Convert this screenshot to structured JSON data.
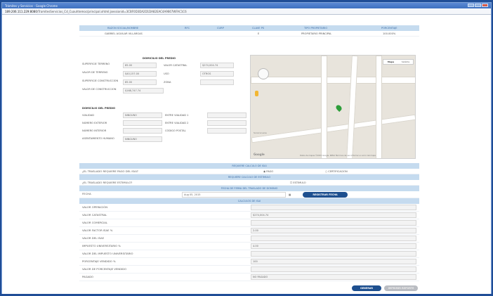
{
  "window": {
    "title": "Trámites y Servicios - Google Chrome"
  },
  "url": {
    "host": "189.206.111.229:8080",
    "path": "/TramitesServicios_Cd_Cuauhtemoc/principal.xhtml;jsessionid=3CBF0D3DA2D1DA82EAC4A9667WFAC1C6"
  },
  "owner": {
    "headers": [
      "RAZON SOCIAL/NOMBRE",
      "RFC",
      "CURP",
      "CLAVE PS",
      "TIPO PROPIETARIO",
      "PORCENTAJE"
    ],
    "values": [
      "GABRIEL AGUILAR VILLARGAS",
      "",
      "",
      "E",
      "PROPIETARIO PRINCIPAL",
      "100.000%"
    ]
  },
  "predio": {
    "title": "DOMICILIO DEL PREDIO",
    "rows": [
      {
        "label": "SUPERFICIE TERRENO",
        "value": "85.00",
        "label2": "VALOR CATASTRAL",
        "value2": "$274,004.74"
      },
      {
        "label": "VALOR DE TERRENO",
        "value": "$40,157.00",
        "label2": "USO",
        "value2": "OTROS"
      },
      {
        "label": "SUPERFICIE CONSTRUCCION",
        "value": "85.00",
        "label2": "ZONA",
        "value2": ""
      },
      {
        "label": "VALOR DE CONSTRUCCION",
        "value": "$168,747.74",
        "label2": "",
        "value2": ""
      }
    ]
  },
  "domicilio": {
    "title": "DOMICILIO DEL PREDIO",
    "rows": [
      {
        "label": "VIALIDAD",
        "value": "NINGUNO",
        "label2": "ENTRE VIALIDAD 1",
        "value2": ""
      },
      {
        "label": "NÚMERO EXTERIOR",
        "value": "",
        "label2": "ENTRE VIALIDAD 2",
        "value2": ""
      },
      {
        "label": "NÚMERO INTERIOR",
        "value": "",
        "label2": "CÓDIGO POSTAL",
        "value2": ""
      },
      {
        "label": "ASENTAMIENTO HUMANO",
        "value": "NINGUNO",
        "label2": "",
        "value2": ""
      }
    ]
  },
  "map": {
    "type_map": "Mapa",
    "type_sat": "Satélite",
    "footer": "Datos de mapas ©2015 Google, INEGI   Términos de uso   Informar un error del mapa",
    "street1": "Sonora Lane",
    "brand": "Google"
  },
  "sections": {
    "calculo_isai": "REQUIERE CALCULO DE ISAI",
    "traslado_q": "¿EL TRASLADO REQUIERE PAGO DEL ISAI?",
    "opt_pago": "PAGO",
    "opt_cert": "CERTIFICACION",
    "estimulo_hdr": "REQUIERE CALCULO DE ESTIMULO",
    "estimulo_q": "¿EL TRASLADO REQUIERE ESTIMULO?",
    "opt_estimulo": "ESTIMULO",
    "fecha_hdr": "FECHA DE FIRMA DEL TRASLADO DE DOMINIO",
    "fecha_label": "FECHA",
    "fecha_value": "Aug 05, 2015",
    "fecha_btn": "REGISTRAR FECHA",
    "calculos_hdr": "CALCULOS DE ISAI"
  },
  "calculos": [
    {
      "label": "VALOR OPERACIÓN",
      "value": ""
    },
    {
      "label": "VALOR CATASTRAL",
      "value": "$274,004.74"
    },
    {
      "label": "VALOR COMERCIAL",
      "value": ""
    },
    {
      "label": "VALOR FACTOR ISAE %",
      "value": "2.00"
    },
    {
      "label": "VALOR DEL ISAE",
      "value": ""
    },
    {
      "label": "IMPUESTO UNIVERSITARIO %",
      "value": "4.00"
    },
    {
      "label": "VALOR DEL IMPUESTO UNIVERSITARIO",
      "value": ""
    },
    {
      "label": "PORCENTAJE VENDIDO %",
      "value": "100"
    },
    {
      "label": "VALOR DE PORCENTAJE VENDIDO",
      "value": ""
    },
    {
      "label": "PAGADO",
      "value": "NO PAGADO"
    }
  ],
  "buttons": {
    "generar": "GENERAR",
    "imprimir": "IMPRIMIR REPORTE"
  },
  "colors": {
    "accent": "#1d4f8f",
    "header": "#c5dbef",
    "frame": "#2a63b8"
  }
}
